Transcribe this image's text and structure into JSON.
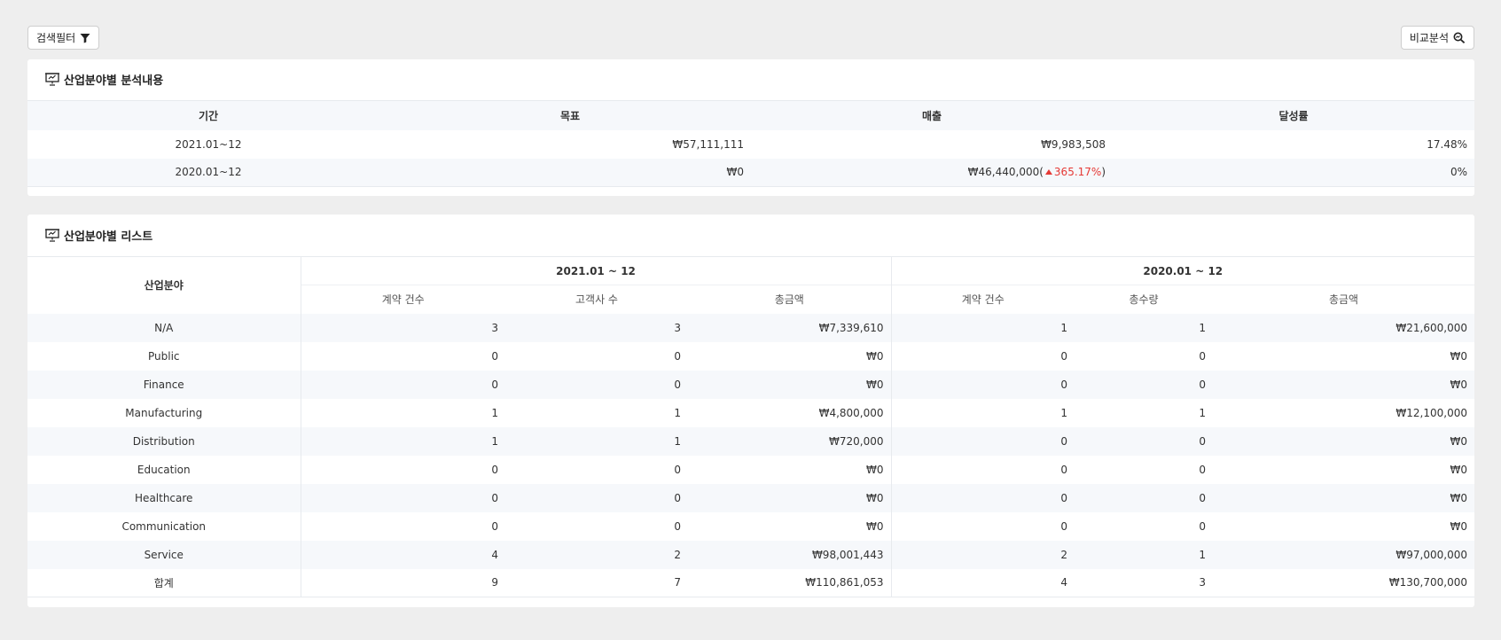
{
  "toolbar": {
    "filter_label": "검색필터",
    "compare_label": "비교분석"
  },
  "summary": {
    "title": "산업분야별 분석내용",
    "columns": [
      "기간",
      "목표",
      "매출",
      "달성률"
    ],
    "rows": [
      {
        "period": "2021.01~12",
        "target": "₩57,111,111",
        "sales": "₩9,983,508",
        "rate": "17.48%"
      },
      {
        "period": "2020.01~12",
        "target": "₩0",
        "sales": "₩46,440,000",
        "sales_change": "365.17%",
        "rate": "0%"
      }
    ]
  },
  "list": {
    "title": "산업분야별 리스트",
    "industry_header": "산업분야",
    "group_2021": "2021.01 ~ 12",
    "group_2020": "2020.01 ~ 12",
    "sub_2021": [
      "계약 건수",
      "고객사 수",
      "총금액"
    ],
    "sub_2020": [
      "계약 건수",
      "총수량",
      "총금액"
    ],
    "rows": [
      {
        "name": "N/A",
        "c21": "3",
        "k21": "3",
        "a21": "₩7,339,610",
        "c20": "1",
        "k20": "1",
        "a20": "₩21,600,000"
      },
      {
        "name": "Public",
        "c21": "0",
        "k21": "0",
        "a21": "₩0",
        "c20": "0",
        "k20": "0",
        "a20": "₩0"
      },
      {
        "name": "Finance",
        "c21": "0",
        "k21": "0",
        "a21": "₩0",
        "c20": "0",
        "k20": "0",
        "a20": "₩0"
      },
      {
        "name": "Manufacturing",
        "c21": "1",
        "k21": "1",
        "a21": "₩4,800,000",
        "c20": "1",
        "k20": "1",
        "a20": "₩12,100,000"
      },
      {
        "name": "Distribution",
        "c21": "1",
        "k21": "1",
        "a21": "₩720,000",
        "c20": "0",
        "k20": "0",
        "a20": "₩0"
      },
      {
        "name": "Education",
        "c21": "0",
        "k21": "0",
        "a21": "₩0",
        "c20": "0",
        "k20": "0",
        "a20": "₩0"
      },
      {
        "name": "Healthcare",
        "c21": "0",
        "k21": "0",
        "a21": "₩0",
        "c20": "0",
        "k20": "0",
        "a20": "₩0"
      },
      {
        "name": "Communication",
        "c21": "0",
        "k21": "0",
        "a21": "₩0",
        "c20": "0",
        "k20": "0",
        "a20": "₩0"
      },
      {
        "name": "Service",
        "c21": "4",
        "k21": "2",
        "a21": "₩98,001,443",
        "c20": "2",
        "k20": "1",
        "a20": "₩97,000,000"
      },
      {
        "name": "합계",
        "c21": "9",
        "k21": "7",
        "a21": "₩110,861,053",
        "c20": "4",
        "k20": "3",
        "a20": "₩130,700,000"
      }
    ]
  },
  "icons": {
    "filter": "funnel-icon",
    "compare": "search-analysis-icon",
    "card": "presentation-chart-icon"
  },
  "colors": {
    "increase": "#e53935"
  }
}
